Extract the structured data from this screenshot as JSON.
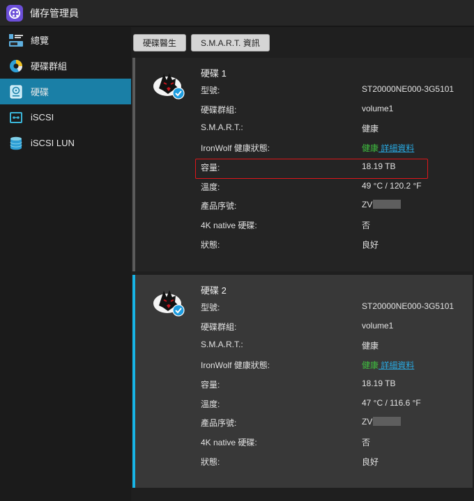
{
  "app": {
    "title": "儲存管理員",
    "icon": "storage-manager-icon"
  },
  "sidebar": {
    "items": [
      {
        "label": "總覽",
        "icon": "overview-icon",
        "active": false
      },
      {
        "label": "硬碟群組",
        "icon": "storage-pool-icon",
        "active": false
      },
      {
        "label": "硬碟",
        "icon": "hdd-icon",
        "active": true
      },
      {
        "label": "iSCSI",
        "icon": "iscsi-icon",
        "active": false
      },
      {
        "label": "iSCSI LUN",
        "icon": "iscsi-lun-icon",
        "active": false
      }
    ]
  },
  "toolbar": {
    "doctor_label": "硬碟醫生",
    "smart_label": "S.M.A.R.T. 資訊"
  },
  "disks": [
    {
      "title": "硬碟 1",
      "logo": "seagate-ironwolf-icon",
      "labels": {
        "model": "型號:",
        "pool": "硬碟群組:",
        "smart": "S.M.A.R.T.:",
        "ironwolf": "IronWolf 健康狀態:",
        "capacity": "容量:",
        "temp": "溫度:",
        "serial": "產品序號:",
        "native4k": "4K native 硬碟:",
        "status": "狀態:"
      },
      "model": "ST20000NE000-3G5101",
      "pool": "volume1",
      "smart": "健康",
      "ironwolf_status": "健康",
      "ironwolf_link": " 詳細資料",
      "capacity": "18.19 TB",
      "temperature": "49 °C / 120.2 °F",
      "serial_prefix": "ZV",
      "native4k": "否",
      "status": "良好"
    },
    {
      "title": "硬碟 2",
      "logo": "seagate-ironwolf-icon",
      "labels": {
        "model": "型號:",
        "pool": "硬碟群組:",
        "smart": "S.M.A.R.T.:",
        "ironwolf": "IronWolf 健康狀態:",
        "capacity": "容量:",
        "temp": "溫度:",
        "serial": "產品序號:",
        "native4k": "4K native 硬碟:",
        "status": "狀態:"
      },
      "model": "ST20000NE000-3G5101",
      "pool": "volume1",
      "smart": "健康",
      "ironwolf_status": "健康",
      "ironwolf_link": " 詳細資料",
      "capacity": "18.19 TB",
      "temperature": "47 °C / 116.6 °F",
      "serial_prefix": "ZV",
      "native4k": "否",
      "status": "良好"
    }
  ],
  "colors": {
    "accent": "#1a7fa6",
    "selected_border": "#18b4e6",
    "health": "#3fbf3f",
    "link": "#29a8e0",
    "highlight": "#e0161a"
  }
}
